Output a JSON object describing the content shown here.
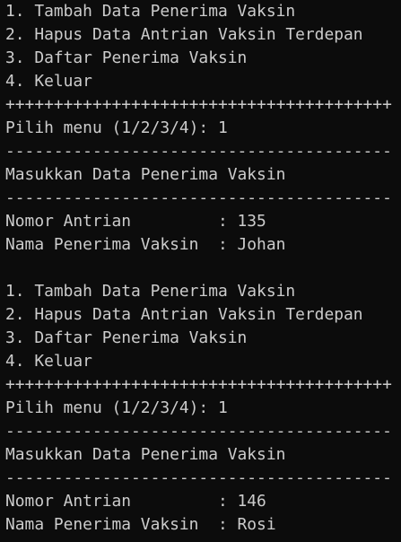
{
  "terminal": {
    "background": "#0c0c0c",
    "foreground": "#cccccc",
    "lines": [
      "1. Tambah Data Penerima Vaksin",
      "2. Hapus Data Antrian Vaksin Terdepan",
      "3. Daftar Penerima Vaksin",
      "4. Keluar",
      "++++++++++++++++++++++++++++++++++++++++",
      "Pilih menu (1/2/3/4): 1",
      "----------------------------------------",
      "Masukkan Data Penerima Vaksin",
      "----------------------------------------",
      "Nomor Antrian         : 135",
      "Nama Penerima Vaksin  : Johan",
      "",
      "1. Tambah Data Penerima Vaksin",
      "2. Hapus Data Antrian Vaksin Terdepan",
      "3. Daftar Penerima Vaksin",
      "4. Keluar",
      "++++++++++++++++++++++++++++++++++++++++",
      "Pilih menu (1/2/3/4): 1",
      "----------------------------------------",
      "Masukkan Data Penerima Vaksin",
      "----------------------------------------",
      "Nomor Antrian         : 146",
      "Nama Penerima Vaksin  : Rosi"
    ]
  }
}
